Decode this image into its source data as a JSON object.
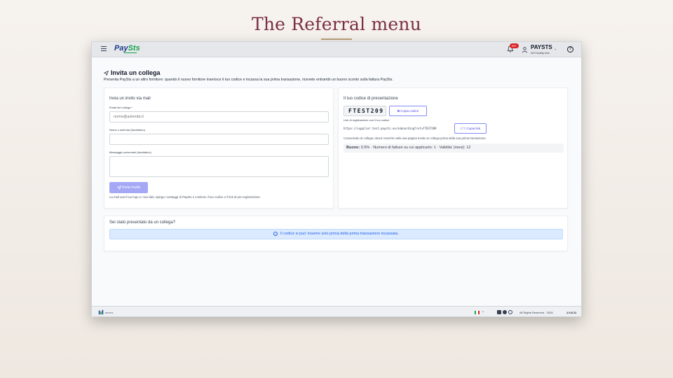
{
  "slide": {
    "title": "The Referral menu"
  },
  "appbar": {
    "logo_main": "Pay",
    "logo_accent": "Sts",
    "notification_badge": "99+",
    "company_name": "PAYSTS",
    "company_subtitle": "2M Facility test",
    "icons": [
      "menu-icon",
      "bell-icon",
      "user-icon",
      "chevron-down-icon",
      "help-icon"
    ]
  },
  "page": {
    "title": "Invita un collega",
    "description": "Presenta PaySts a un altro fornitore: quando il nuovo fornitore inserisce il tuo codice e incassa la sua prima transazione, ricevete entrambi un buono sconto sulla fattura PaySts."
  },
  "invite_form": {
    "heading": "Invia un invito via mail",
    "email_label": "Email del collega *",
    "email_placeholder": "nome@azienda.it",
    "name_label": "Nome o azienda (facoltativo)",
    "name_value": "",
    "message_label": "Messaggio personale (facoltativo)",
    "message_value": "",
    "send_label": "Invia invito",
    "note": "La mail usa il tuo logo e i tuoi dati, spiega i vantaggi di PaySts e contiene il tuo codice e il link di pre-registrazione."
  },
  "referral_code": {
    "heading": "Il tuo codice di presentazione",
    "code": "FTEST209",
    "copy_code_label": "Copia codice",
    "link_label": "Link di registrazione con il tuo codice",
    "link_url": "https://supplier.test.paysts.eu/onboarding?ref=FTEST209",
    "copy_link_label": "Copia link",
    "link_hint": "Comunicalo al collega: dovra' inserirlo nella sua pagina Invita un collega prima della sua prima transazione.",
    "voucher_label": "Buono:",
    "voucher_text": "0.5% · Numero di fatture su cui applicarlo: 1 · Validita' (mesi): 12"
  },
  "referred_by": {
    "heading": "Sei stato presentato da un collega?",
    "info": "Il codice si puo' inserire solo prima della prima transazione incassata."
  },
  "footer": {
    "logo_text": "PAYSTS",
    "copyright": "All Rights Reserved · 2026",
    "version": "1.0.8.11",
    "icons": [
      "italy-flag-icon",
      "chevron-down-icon",
      "linkedin-icon",
      "facebook-icon",
      "globe-icon"
    ]
  },
  "colors": {
    "brand_blue": "#1e3a8a",
    "brand_green": "#16a34a",
    "primary_button": "#a5a9f5",
    "accent_indigo": "#4f46e5",
    "info_bg": "#dbeafe",
    "title_color": "#7a2e44"
  }
}
